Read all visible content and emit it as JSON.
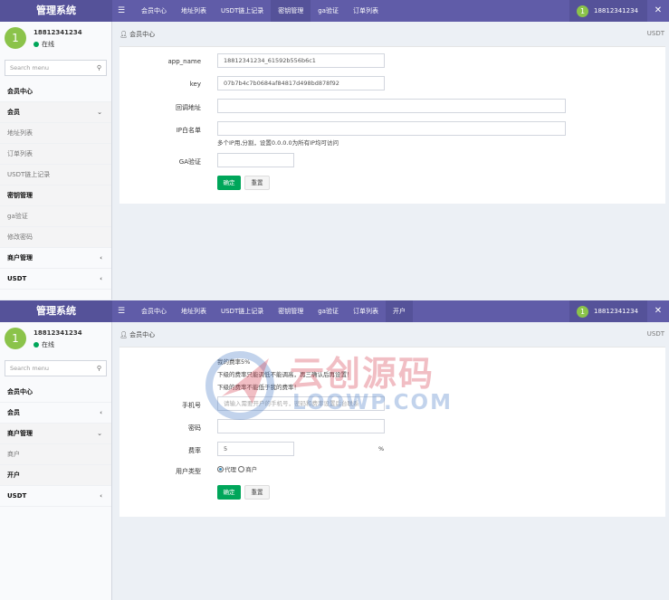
{
  "colors": {
    "topbar": "#605ca8",
    "topbar_dark": "#555299",
    "avatar": "#8bc34a",
    "online": "#00a65a",
    "confirm_button": "#00a65a",
    "radio": "#3c8dbc"
  },
  "icons": {
    "menu_toggle": "hamburger-icon",
    "crumb": "user-icon",
    "search": "search-icon",
    "close": "close-icon",
    "chevron": "chevron-icon"
  },
  "panel1": {
    "brand": "管理系统",
    "nav": [
      "会员中心",
      "地址列表",
      "USDT链上记录",
      "密钥管理",
      "ga验证",
      "订单列表"
    ],
    "active_nav": "密钥管理",
    "user": {
      "avatar": "1",
      "name": "18812341234",
      "status": "在线"
    },
    "search_placeholder": "Search menu",
    "sidebar": [
      {
        "label": "会员中心",
        "kind": "header"
      },
      {
        "label": "会员",
        "kind": "group-open",
        "chev": "⌄"
      },
      {
        "label": "地址列表",
        "kind": "sub"
      },
      {
        "label": "订单列表",
        "kind": "sub"
      },
      {
        "label": "USDT链上记录",
        "kind": "sub"
      },
      {
        "label": "密钥管理",
        "kind": "sub-current"
      },
      {
        "label": "ga验证",
        "kind": "sub"
      },
      {
        "label": "修改密码",
        "kind": "sub"
      },
      {
        "label": "商户管理",
        "kind": "group",
        "chev": "‹"
      },
      {
        "label": "USDT",
        "kind": "group",
        "chev": "‹"
      }
    ],
    "breadcrumb": "会员中心",
    "breadcrumb_right": "USDT",
    "form": {
      "app_name_label": "app_name",
      "app_name_value": "18812341234_61592b556b6c1",
      "key_label": "key",
      "key_value": "07b7b4c7b0684af84817d498bd878f92",
      "callback_label": "回调地址",
      "callback_value": "",
      "ip_label": "IP白名单",
      "ip_value": "",
      "ip_help": "多个IP用,分割，设置0.0.0.0为所有IP均可访问",
      "ga_label": "GA验证",
      "ga_value": "",
      "confirm": "确定",
      "reset": "重置"
    }
  },
  "panel2": {
    "brand": "管理系统",
    "nav": [
      "会员中心",
      "地址列表",
      "USDT链上记录",
      "密钥管理",
      "ga验证",
      "订单列表",
      "开户"
    ],
    "active_nav": "开户",
    "user": {
      "avatar": "1",
      "name": "18812341234",
      "status": "在线"
    },
    "search_placeholder": "Search menu",
    "sidebar": [
      {
        "label": "会员中心",
        "kind": "header"
      },
      {
        "label": "会员",
        "kind": "group",
        "chev": "‹"
      },
      {
        "label": "商户管理",
        "kind": "group-open",
        "chev": "⌄"
      },
      {
        "label": "商户",
        "kind": "sub"
      },
      {
        "label": "开户",
        "kind": "sub-current"
      },
      {
        "label": "USDT",
        "kind": "group",
        "chev": "‹"
      }
    ],
    "breadcrumb": "会员中心",
    "breadcrumb_right": "USDT",
    "form": {
      "notice1": "我的费率5%",
      "notice2": "下级的费率只能调低不能调高，再三确认后再设置！",
      "notice3": "下级的费率不能低于我的费率！",
      "phone_label": "手机号",
      "phone_placeholder": "请输入需要开户的手机号，密码和费率设置后台联系",
      "password_label": "密码",
      "password_value": "",
      "rate_label": "费率",
      "rate_value": "5",
      "rate_unit": "%",
      "type_label": "用户类型",
      "type_options": [
        "代理",
        "商户"
      ],
      "type_selected": "代理",
      "confirm": "确定",
      "reset": "重置"
    },
    "watermark": {
      "cn": "云创源码",
      "en": "LOOWP.COM"
    }
  }
}
